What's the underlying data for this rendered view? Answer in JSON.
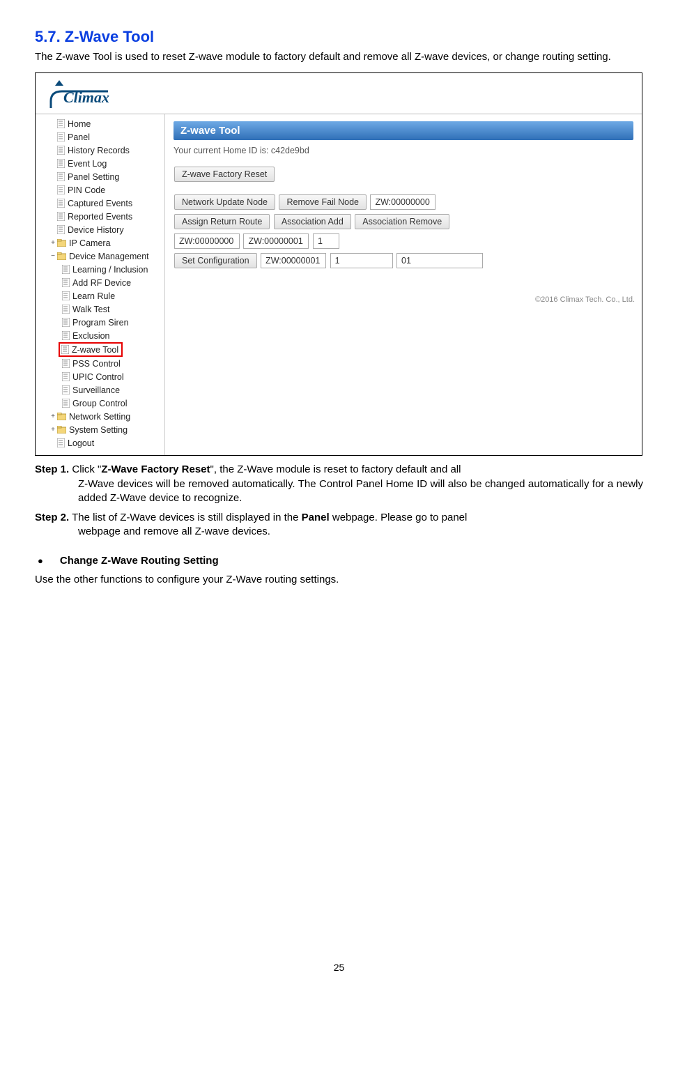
{
  "section_title": "5.7. Z-Wave Tool",
  "intro": "The Z-wave Tool is used to reset Z-wave module to factory default and remove all Z-wave devices, or change routing setting.",
  "screenshot": {
    "logo_text": "Climax",
    "nav": {
      "items": [
        "Home",
        "Panel",
        "History Records",
        "Event Log",
        "Panel Setting",
        "PIN Code",
        "Captured Events",
        "Reported Events",
        "Device History"
      ],
      "ip_camera": "IP Camera",
      "device_mgmt": "Device Management",
      "device_sub": [
        "Learning / Inclusion",
        "Add RF Device",
        "Learn Rule",
        "Walk Test",
        "Program Siren",
        "Exclusion"
      ],
      "highlight": "Z-wave Tool",
      "device_sub2": [
        "PSS Control",
        "UPIC Control",
        "Surveillance",
        "Group Control"
      ],
      "network": "Network Setting",
      "system": "System Setting",
      "logout": "Logout"
    },
    "content": {
      "title": "Z-wave Tool",
      "home_id": "Your current Home ID is: c42de9bd",
      "factory_reset": "Z-wave Factory Reset",
      "row1": {
        "btn1": "Network Update Node",
        "btn2": "Remove Fail Node",
        "txt1": "ZW:00000000"
      },
      "row2": {
        "btn1": "Assign Return Route",
        "btn2": "Association Add",
        "btn3": "Association Remove"
      },
      "row3": {
        "txt1": "ZW:00000000",
        "txt2": "ZW:00000001",
        "txt3": "1"
      },
      "row4": {
        "btn1": "Set Configuration",
        "txt1": "ZW:00000001",
        "txt2": "1",
        "txt3": "01"
      },
      "copyright": "©2016 Climax Tech. Co., Ltd."
    }
  },
  "steps": {
    "s1_label": "Step 1.",
    "s1_pre": "  Click \"",
    "s1_bold": "Z-Wave Factory Reset",
    "s1_post": "\", the Z-Wave module is reset to factory default and all Z-Wave devices will be removed automatically. The Control Panel Home ID will also be changed automatically for a newly added Z-Wave device to recognize.",
    "s2_label": "Step 2.",
    "s2_pre": " The list of Z-Wave devices is still displayed in the ",
    "s2_bold": "Panel",
    "s2_post": " webpage. Please go to panel webpage and remove all Z-wave devices."
  },
  "sub_heading": "Change Z-Wave Routing Setting",
  "sub_text": "Use the other functions to configure your Z-Wave routing settings.",
  "page_number": "25"
}
